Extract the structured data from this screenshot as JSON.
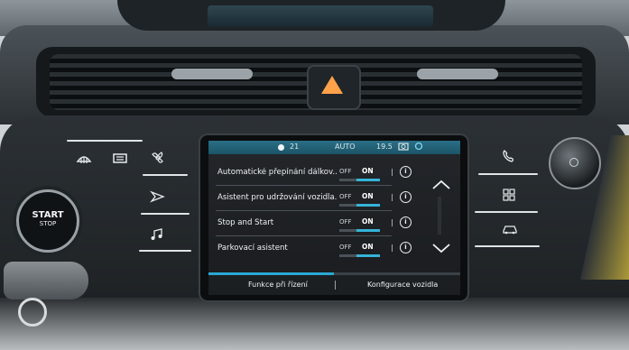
{
  "status_bar": {
    "time": "21",
    "climate_mode": "AUTO",
    "temperature": "19.5"
  },
  "left_panel": {
    "button_icons": [
      "front-defrost-icon",
      "rear-defrost-icon",
      "fan-icon",
      "navigation-icon",
      "music-icon"
    ],
    "start_label": "START",
    "start_sub": "STOP"
  },
  "right_panel": {
    "button_icons": [
      "phone-icon",
      "apps-grid-icon",
      "car-icon",
      "power-volume-knob-icon"
    ]
  },
  "settings": [
    {
      "label": "Automatické přepínání dálkov...",
      "off": "OFF",
      "on": "ON",
      "state": "on"
    },
    {
      "label": "Asistent pro udržování vozidla...",
      "off": "OFF",
      "on": "ON",
      "state": "on"
    },
    {
      "label": "Stop and Start",
      "off": "OFF",
      "on": "ON",
      "state": "on"
    },
    {
      "label": "Parkovací asistent",
      "off": "OFF",
      "on": "ON",
      "state": "on"
    }
  ],
  "tabs": [
    {
      "label": "Funkce při řízení",
      "active": true
    },
    {
      "label": "Konfigurace vozidla",
      "active": false
    }
  ],
  "colors": {
    "accent": "#2aa8d3",
    "hazard": "#ffa24a",
    "status_bar": "#2b6f86"
  }
}
